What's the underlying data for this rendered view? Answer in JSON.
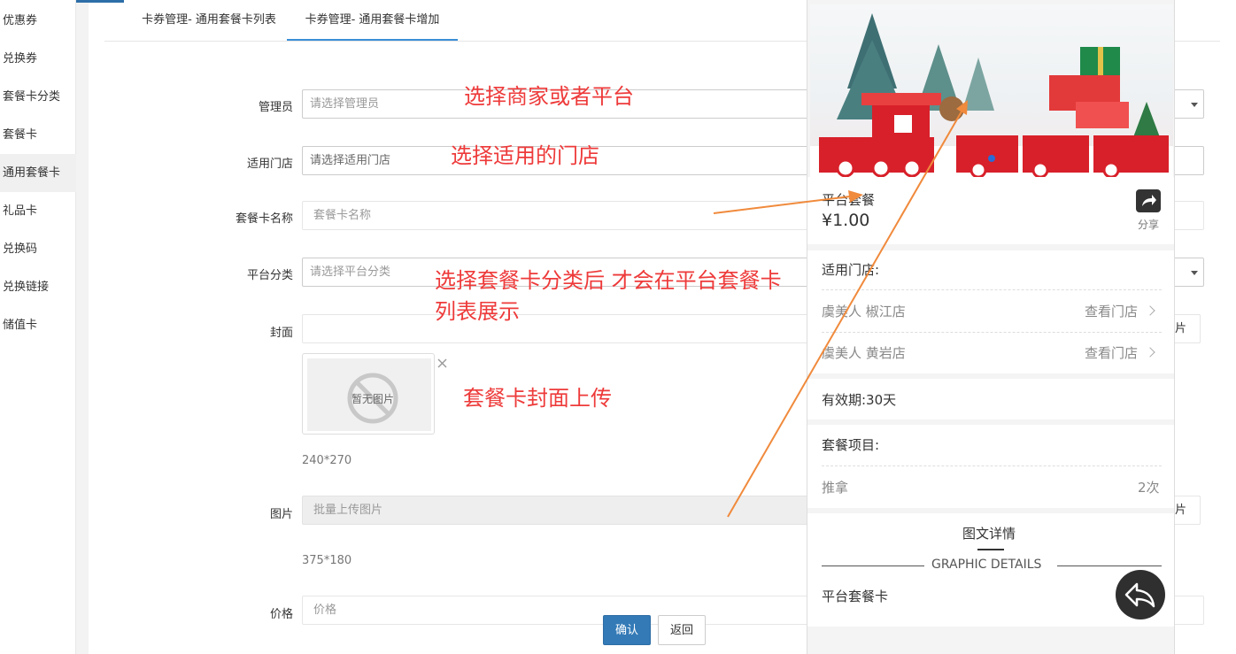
{
  "sidebar": {
    "items": [
      {
        "label": "优惠券",
        "active": false
      },
      {
        "label": "兑换券",
        "active": false
      },
      {
        "label": "套餐卡分类",
        "active": false
      },
      {
        "label": "套餐卡",
        "active": false
      },
      {
        "label": "通用套餐卡",
        "active": true
      },
      {
        "label": "礼品卡",
        "active": false
      },
      {
        "label": "兑换码",
        "active": false
      },
      {
        "label": "兑换链接",
        "active": false
      },
      {
        "label": "储值卡",
        "active": false
      }
    ]
  },
  "tabs": [
    {
      "label": "卡券管理- 通用套餐卡列表",
      "active": false
    },
    {
      "label": "卡券管理- 通用套餐卡增加",
      "active": true
    }
  ],
  "form": {
    "manager": {
      "label": "管理员",
      "placeholder": "请选择管理员"
    },
    "store": {
      "label": "适用门店",
      "placeholder": "请选择适用门店"
    },
    "name": {
      "label": "套餐卡名称",
      "placeholder": "套餐卡名称"
    },
    "category": {
      "label": "平台分类",
      "placeholder": "请选择平台分类"
    },
    "cover": {
      "label": "封面",
      "empty_text": "暂无图片",
      "size_hint": "240*270",
      "upload_label_fragment": "片"
    },
    "images": {
      "label": "图片",
      "placeholder": "批量上传图片",
      "size_hint": "375*180",
      "upload_label_fragment": "片"
    },
    "price": {
      "label": "价格",
      "placeholder": "价格"
    },
    "confirm_label": "确认",
    "back_label": "返回"
  },
  "annotations": [
    "选择商家或者平台",
    "选择适用的门店",
    "选择套餐卡分类后 才会在平台套餐卡",
    "列表展示",
    "套餐卡封面上传"
  ],
  "preview": {
    "title": "平台套餐",
    "price": "¥1.00",
    "share_label": "分享",
    "stores_label": "适用门店:",
    "stores": [
      {
        "name": "虞美人 椒江店",
        "link": "查看门店"
      },
      {
        "name": "虞美人 黄岩店",
        "link": "查看门店"
      }
    ],
    "validity": "有效期:30天",
    "items_label": "套餐项目:",
    "items": [
      {
        "name": "推拿",
        "count": "2次"
      }
    ],
    "detail_tab": "图文详情",
    "detail_subtitle": "GRAPHIC DETAILS",
    "detail_text": "平台套餐卡"
  },
  "colors": {
    "accent": "#3a8fd6",
    "primary_button": "#337ab7",
    "annotation": "#ee3a3a",
    "arrow": "#f08a3c"
  }
}
